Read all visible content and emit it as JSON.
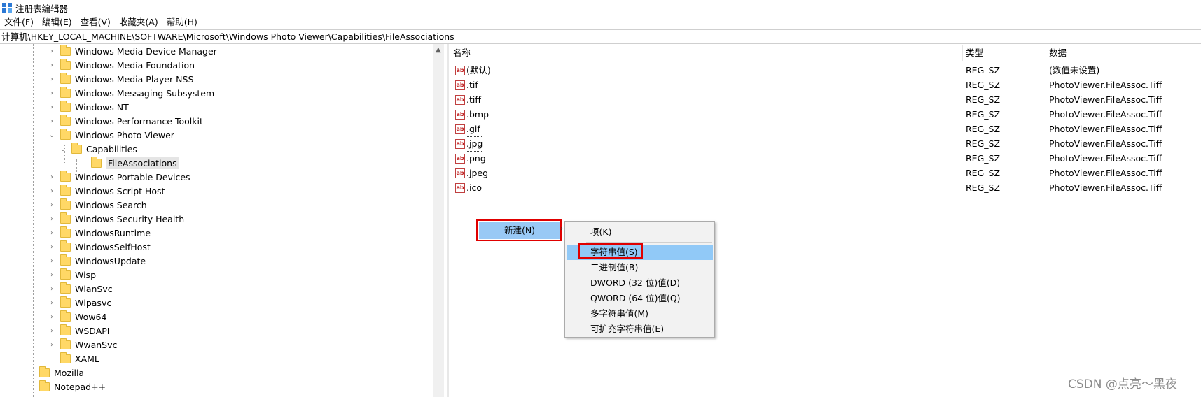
{
  "window": {
    "title": "注册表编辑器"
  },
  "menu": [
    "文件(F)",
    "编辑(E)",
    "查看(V)",
    "收藏夹(A)",
    "帮助(H)"
  ],
  "address": "计算机\\HKEY_LOCAL_MACHINE\\SOFTWARE\\Microsoft\\Windows Photo Viewer\\Capabilities\\FileAssociations",
  "tree": {
    "items": [
      {
        "label": "Windows Media Device Manager",
        "chev": ">"
      },
      {
        "label": "Windows Media Foundation",
        "chev": ">"
      },
      {
        "label": "Windows Media Player NSS",
        "chev": ">"
      },
      {
        "label": "Windows Messaging Subsystem",
        "chev": ">"
      },
      {
        "label": "Windows NT",
        "chev": ">"
      },
      {
        "label": "Windows Performance Toolkit",
        "chev": ">"
      },
      {
        "label": "Windows Photo Viewer",
        "chev": "v"
      },
      {
        "label": "Capabilities",
        "chev": "v"
      },
      {
        "label": "FileAssociations",
        "chev": ""
      },
      {
        "label": "Windows Portable Devices",
        "chev": ">"
      },
      {
        "label": "Windows Script Host",
        "chev": ">"
      },
      {
        "label": "Windows Search",
        "chev": ">"
      },
      {
        "label": "Windows Security Health",
        "chev": ">"
      },
      {
        "label": "WindowsRuntime",
        "chev": ">"
      },
      {
        "label": "WindowsSelfHost",
        "chev": ">"
      },
      {
        "label": "WindowsUpdate",
        "chev": ">"
      },
      {
        "label": "Wisp",
        "chev": ">"
      },
      {
        "label": "WlanSvc",
        "chev": ">"
      },
      {
        "label": "Wlpasvc",
        "chev": ">"
      },
      {
        "label": "Wow64",
        "chev": ">"
      },
      {
        "label": "WSDAPI",
        "chev": ">"
      },
      {
        "label": "WwanSvc",
        "chev": ">"
      },
      {
        "label": "XAML",
        "chev": ""
      },
      {
        "label": "Mozilla",
        "chev": ""
      },
      {
        "label": "Notepad++",
        "chev": ""
      }
    ]
  },
  "list": {
    "headers": {
      "name": "名称",
      "type": "类型",
      "data": "数据"
    },
    "icon_text": "ab",
    "rows": [
      {
        "name": "(默认)",
        "type": "REG_SZ",
        "data": "(数值未设置)"
      },
      {
        "name": ".tif",
        "type": "REG_SZ",
        "data": "PhotoViewer.FileAssoc.Tiff"
      },
      {
        "name": ".tiff",
        "type": "REG_SZ",
        "data": "PhotoViewer.FileAssoc.Tiff"
      },
      {
        "name": ".bmp",
        "type": "REG_SZ",
        "data": "PhotoViewer.FileAssoc.Tiff"
      },
      {
        "name": ".gif",
        "type": "REG_SZ",
        "data": "PhotoViewer.FileAssoc.Tiff"
      },
      {
        "name": ".jpg",
        "type": "REG_SZ",
        "data": "PhotoViewer.FileAssoc.Tiff"
      },
      {
        "name": ".png",
        "type": "REG_SZ",
        "data": "PhotoViewer.FileAssoc.Tiff"
      },
      {
        "name": ".jpeg",
        "type": "REG_SZ",
        "data": "PhotoViewer.FileAssoc.Tiff"
      },
      {
        "name": ".ico",
        "type": "REG_SZ",
        "data": "PhotoViewer.FileAssoc.Tiff"
      }
    ]
  },
  "context_menu": {
    "new_label": "新建(N)",
    "items": [
      "项(K)",
      "字符串值(S)",
      "二进制值(B)",
      "DWORD (32 位)值(D)",
      "QWORD (64 位)值(Q)",
      "多字符串值(M)",
      "可扩充字符串值(E)"
    ]
  },
  "watermark": "CSDN @点亮～黑夜",
  "colors": {
    "highlight": "#91c9f7",
    "annotation_red": "#e00000",
    "folder": "#ffd866"
  }
}
